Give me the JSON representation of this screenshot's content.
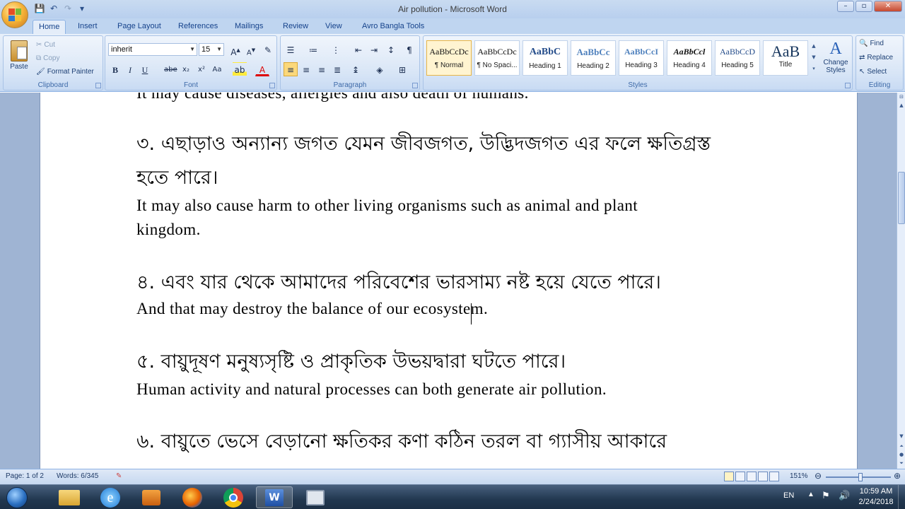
{
  "window": {
    "title": "Air pollution - Microsoft Word",
    "controls": [
      "–",
      "▫",
      "✕"
    ]
  },
  "tabs": [
    "Home",
    "Insert",
    "Page Layout",
    "References",
    "Mailings",
    "Review",
    "View",
    "Avro Bangla Tools"
  ],
  "clipboard": {
    "label": "Clipboard",
    "paste": "Paste",
    "cut": "Cut",
    "copy": "Copy",
    "format_painter": "Format Painter"
  },
  "font": {
    "label": "Font",
    "name": "inherit",
    "size": "15"
  },
  "paragraph": {
    "label": "Paragraph"
  },
  "styles": {
    "label": "Styles",
    "items": [
      {
        "preview": "AaBbCcDc",
        "name": "¶ Normal"
      },
      {
        "preview": "AaBbCcDc",
        "name": "¶ No Spaci..."
      },
      {
        "preview": "AaBbC",
        "name": "Heading 1"
      },
      {
        "preview": "AaBbCc",
        "name": "Heading 2"
      },
      {
        "preview": "AaBbCcI",
        "name": "Heading 3"
      },
      {
        "preview": "AaBbCcl",
        "name": "Heading 4"
      },
      {
        "preview": "AaBbCcD",
        "name": "Heading 5"
      },
      {
        "preview": "AaB",
        "name": "Title"
      }
    ],
    "change_styles": "Change Styles"
  },
  "editing": {
    "label": "Editing",
    "find": "Find",
    "replace": "Replace",
    "select": "Select"
  },
  "document": {
    "lines": [
      {
        "lang": "en",
        "text": "It may cause diseases, allergies and also death of humans."
      },
      {
        "lang": "bn",
        "text": "৩. এছাড়াও অন্যান্য জগত যেমন জীবজগত, উদ্ভিদজগত এর ফলে ক্ষতিগ্রস্ত"
      },
      {
        "lang": "bn",
        "text": "হতে পারে।"
      },
      {
        "lang": "en",
        "text": "It may also cause harm to other living organisms such as animal and plant"
      },
      {
        "lang": "en",
        "text": "kingdom."
      },
      {
        "lang": "bn",
        "text": "৪. এবং যার থেকে আমাদের পরিবেশের ভারসাম্য নষ্ট হয়ে যেতে পারে।"
      },
      {
        "lang": "en",
        "text": "And that may destroy the balance of our ecosystem."
      },
      {
        "lang": "bn",
        "text": "৫. বায়ুদূষণ মনুষ্যসৃষ্টি ও প্রাকৃতিক উভয়দ্বারা ঘটতে পারে।"
      },
      {
        "lang": "en",
        "text": "Human activity and natural processes can both generate air pollution."
      },
      {
        "lang": "bn",
        "text": "৬. বায়ুতে ভেসে বেড়ানো ক্ষতিকর কণা কঠিন তরল বা গ্যাসীয় আকারে"
      }
    ]
  },
  "statusbar": {
    "page": "Page: 1 of 2",
    "words": "Words: 6/345",
    "zoom": "151%"
  },
  "taskbar": {
    "lang": "EN",
    "time": "10:59 AM",
    "date": "2/24/2018"
  }
}
